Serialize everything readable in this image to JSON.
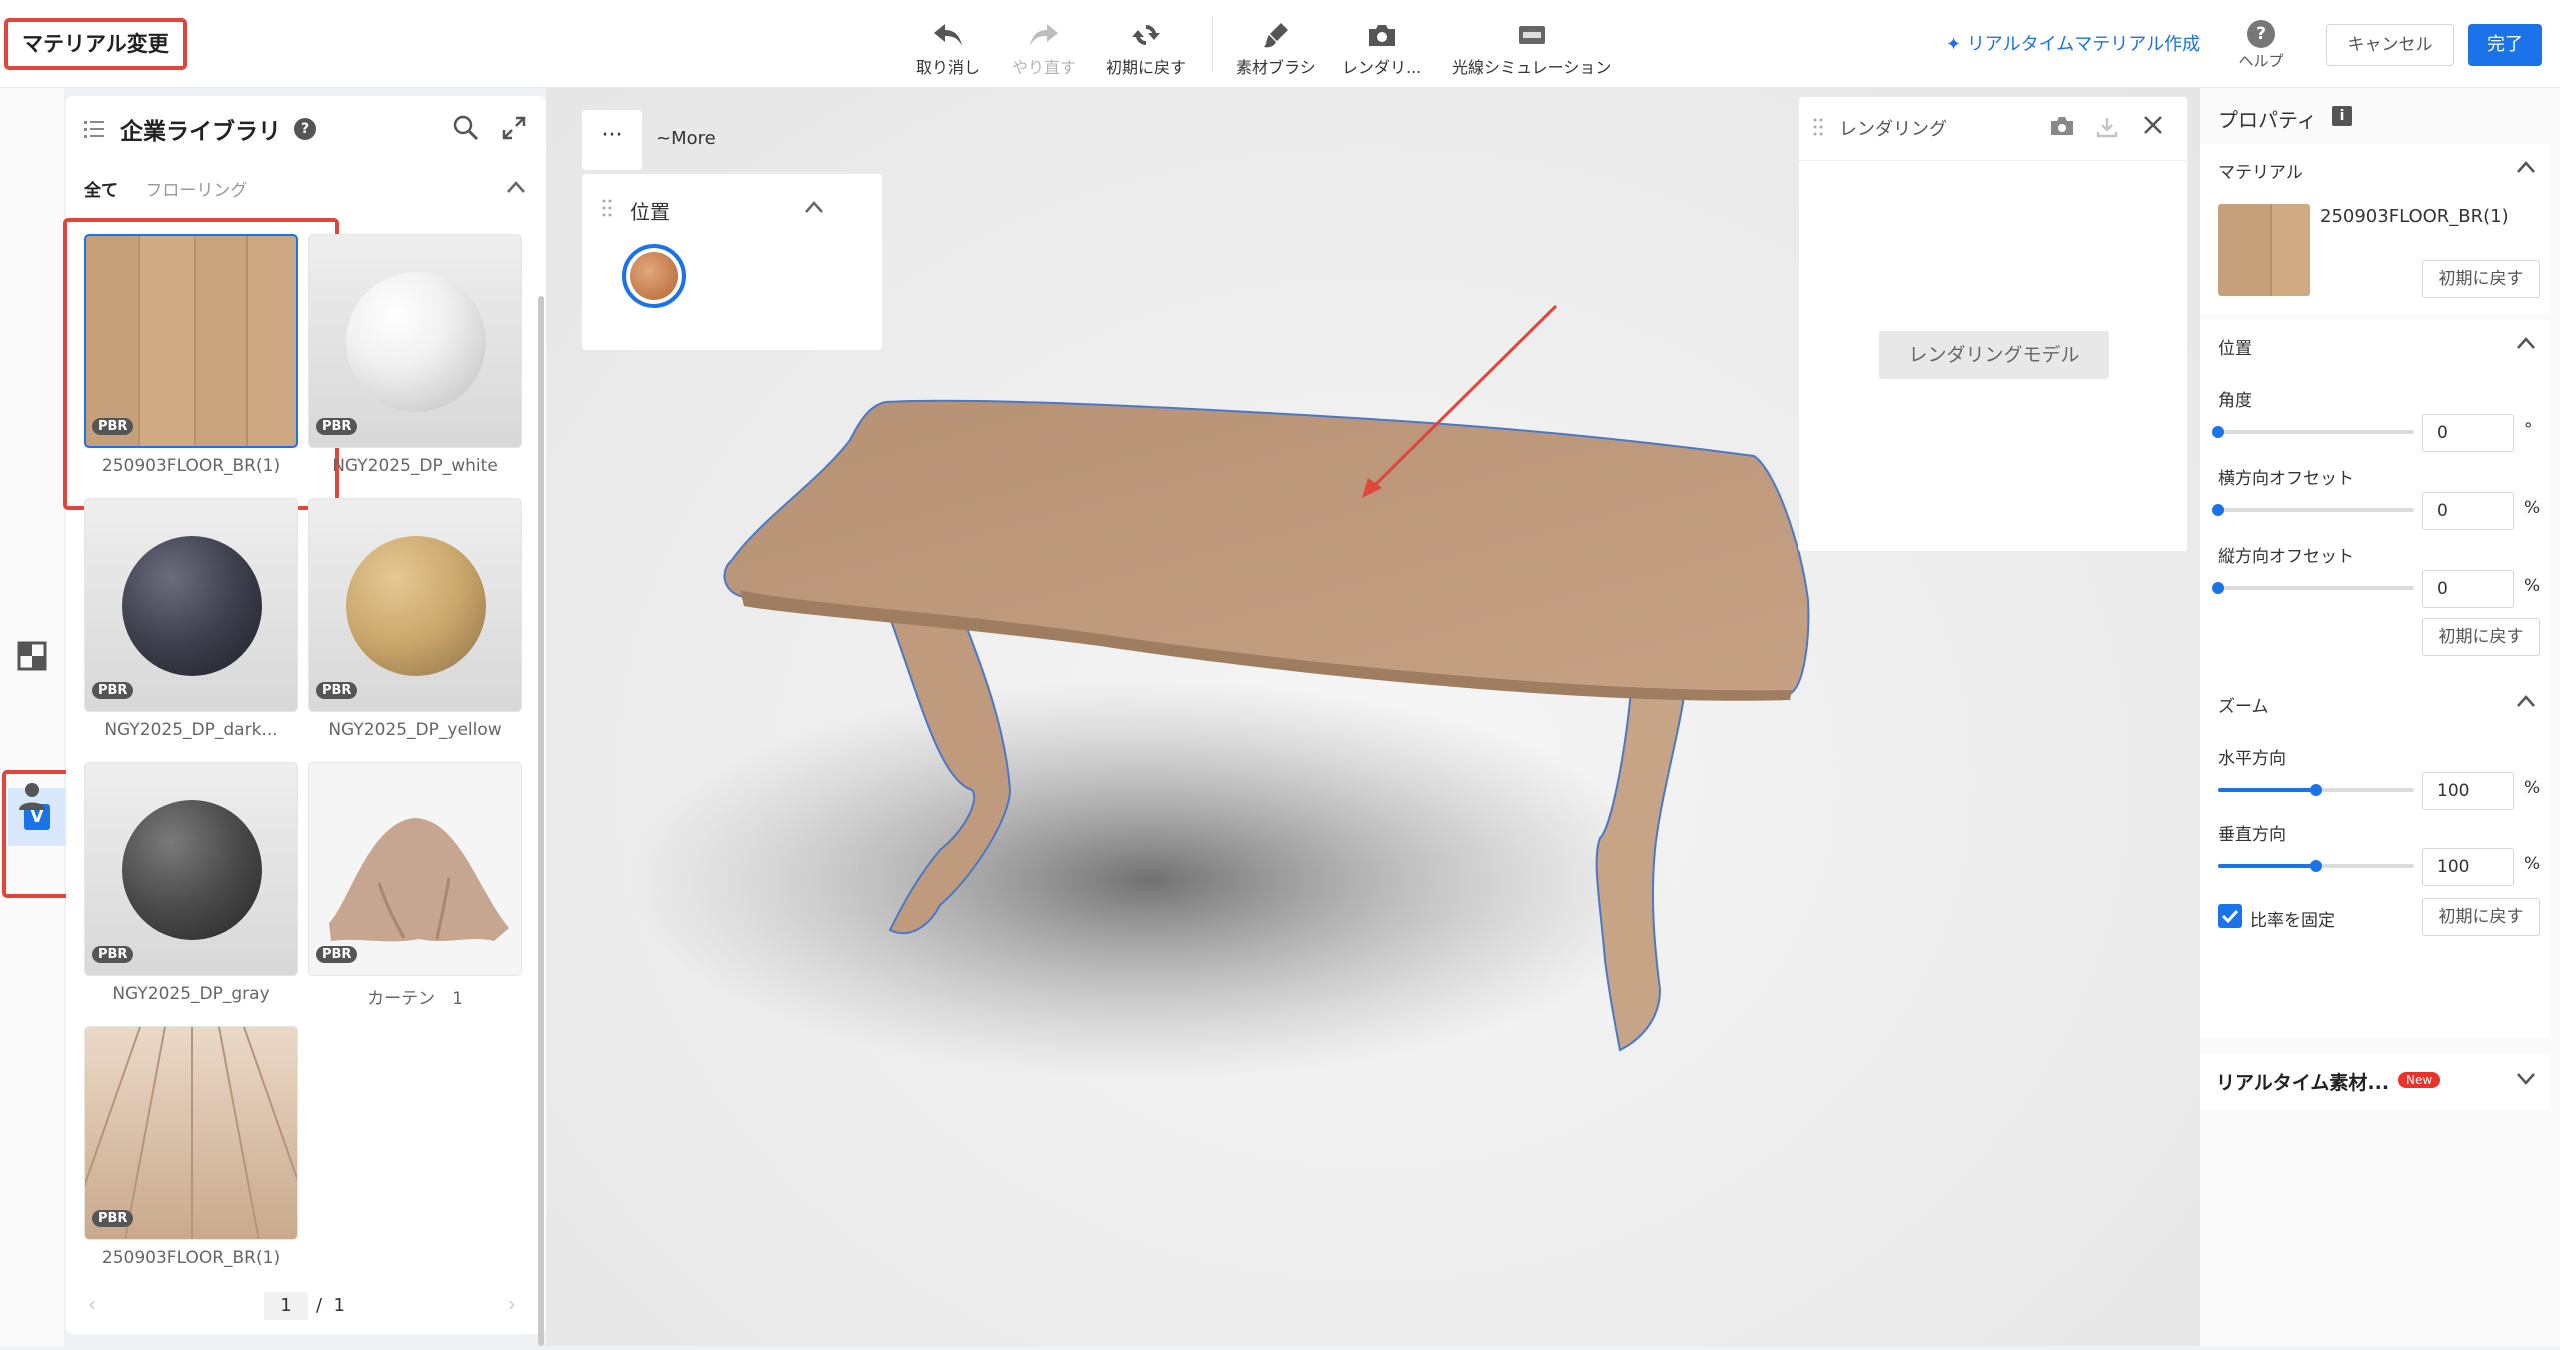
{
  "app": {
    "title": "マテリアル変更"
  },
  "toolbar": {
    "undo": "取り消し",
    "redo": "やり直す",
    "reset": "初期に戻す",
    "brush": "素材ブラシ",
    "render": "レンダリ...",
    "light": "光線シミュレーション"
  },
  "header_right": {
    "realtime": "リアルタイムマテリアル作成",
    "help": "ヘルプ",
    "help_glyph": "?",
    "cancel": "キャンセル",
    "done": "完了"
  },
  "rail": {
    "v_label": "V"
  },
  "library": {
    "title": "企業ライブラリ",
    "tabs": [
      "全て",
      "フローリング"
    ],
    "pbr": "PBR",
    "items": [
      {
        "name": "250903FLOOR_BR(1)",
        "kind": "wood-board",
        "selected": true
      },
      {
        "name": "NGY2025_DP_white",
        "kind": "sphere",
        "color": "#f2f2f2"
      },
      {
        "name": "NGY2025_DP_dark...",
        "kind": "sphere",
        "color": "#3e3f4d"
      },
      {
        "name": "NGY2025_DP_yellow",
        "kind": "sphere",
        "color": "#c9a66b"
      },
      {
        "name": "NGY2025_DP_gray",
        "kind": "sphere",
        "color": "#4a4a4a"
      },
      {
        "name": "カーテン　1",
        "kind": "cloth",
        "color": "#c6a591"
      },
      {
        "name": "250903FLOOR_BR(1)",
        "kind": "floor-perspective"
      }
    ],
    "pager": {
      "current": "1",
      "separator": "/",
      "total": "1"
    }
  },
  "viewport": {
    "more_glyph": "···",
    "more_label": "~More",
    "position_title": "位置"
  },
  "render_panel": {
    "title": "レンダリング",
    "button": "レンダリングモデル"
  },
  "props": {
    "title": "プロパティ",
    "info_glyph": "i",
    "material_section": "マテリアル",
    "material_name": "250903FLOOR_BR(1)",
    "reset": "初期に戻す",
    "position_section": "位置",
    "angle_label": "角度",
    "angle_value": "0",
    "angle_unit": "°",
    "h_offset_label": "横方向オフセット",
    "h_offset_value": "0",
    "v_offset_label": "縦方向オフセット",
    "v_offset_value": "0",
    "percent": "%",
    "zoom_section": "ズーム",
    "zoom_h_label": "水平方向",
    "zoom_h_value": "100",
    "zoom_v_label": "垂直方向",
    "zoom_v_value": "100",
    "lock_ratio": "比率を固定",
    "lock_ratio_checked": true,
    "zoom_h_level": 0.5,
    "zoom_v_level": 0.5,
    "realtime_section": "リアルタイム素材...",
    "new_badge": "New"
  },
  "colors": {
    "accent": "#1a73e8",
    "highlight": "#e0463b",
    "wood": "#c6a07a"
  }
}
